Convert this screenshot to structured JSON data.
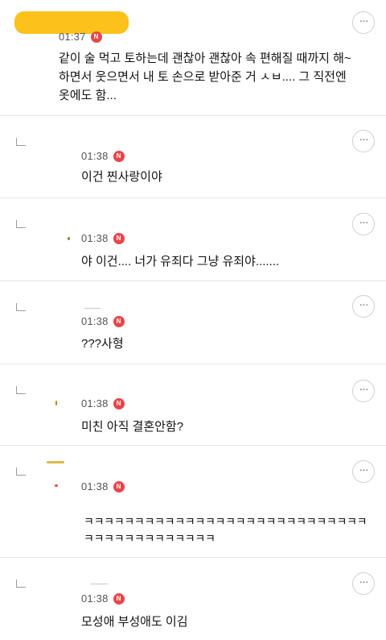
{
  "comments": [
    {
      "time": "01:37",
      "badge": "N",
      "text": "같이 술 먹고 토하는데 괜찮아 괜찮아 속 편해질 때까지 해~ 하면서 웃으면서 내 토 손으로 받아준 거 ㅅㅂ.... 그 직전엔 옷에도 함...",
      "more": "···"
    },
    {
      "time": "01:38",
      "badge": "N",
      "text": "이건 찐사랑이야",
      "more": "···"
    },
    {
      "time": "01:38",
      "badge": "N",
      "text": "야 이건.... 너가 유죄다 그냥 유죄야.......",
      "more": "···"
    },
    {
      "time": "01:38",
      "badge": "N",
      "text": "???사형",
      "more": "···"
    },
    {
      "time": "01:38",
      "badge": "N",
      "text": "미친 아직 결혼안함?",
      "more": "···"
    },
    {
      "time": "01:38",
      "badge": "N",
      "text": "ㅋㅋㅋㅋㅋㅋㅋㅋㅋㅋㅋㅋㅋㅋㅋㅋㅋㅋㅋㅋㅋㅋㅋㅋㅋㅋㅋㅋㅋㅋㅋㅋㅋㅋㅋㅋㅋㅋㅋㅋㅋ",
      "more": "···"
    },
    {
      "time": "01:38",
      "badge": "N",
      "text": "모성애 부성애도 이김",
      "more": "···"
    }
  ],
  "colors": {
    "badge": "#e8454a",
    "redaction": "#fcc21b",
    "divider": "#e6e6e6"
  },
  "icons": {
    "reply": "reply-arrow-icon",
    "more": "more-options-icon"
  }
}
